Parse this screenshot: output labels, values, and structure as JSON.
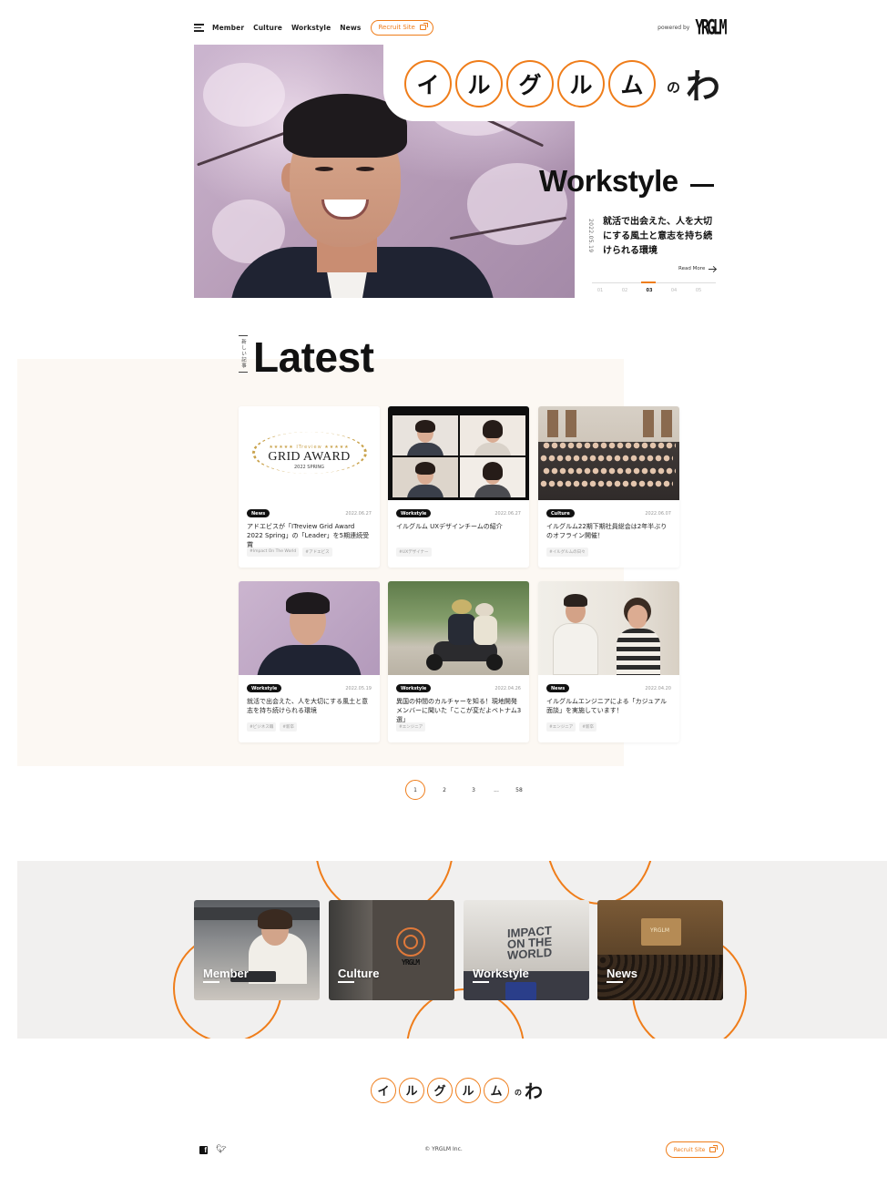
{
  "header": {
    "nav": [
      "Member",
      "Culture",
      "Workstyle",
      "News"
    ],
    "recruit_label": "Recruit Site",
    "powered_by": "powered by",
    "logo_text": "YRGLM"
  },
  "hero": {
    "brand_chars": [
      "イ",
      "ル",
      "グ",
      "ル",
      "ム"
    ],
    "brand_no": "の",
    "brand_wa": "わ",
    "category": "Workstyle",
    "date": "2022.05.19",
    "title": "就活で出会えた、人を大切にする風土と意志を持ち続けられる環境",
    "read_more": "Read More",
    "slides": [
      "01",
      "02",
      "03",
      "04",
      "05"
    ],
    "active_slide": 3
  },
  "latest": {
    "vertical_tag": "新しい記事",
    "title": "Latest",
    "articles": [
      {
        "category": "News",
        "date": "2022.06.27",
        "title": "アドエビスが「ITreview Grid Award 2022 Spring」の「Leader」を5期連続受賞",
        "tags": [
          "#Impact On The World",
          "#アドエビス"
        ],
        "image": {
          "award_title": "GRID AWARD",
          "award_sub": "2022 SPRING",
          "award_stars": "★★★★★ ITreview ★★★★★"
        }
      },
      {
        "category": "Workstyle",
        "date": "2022.06.27",
        "title": "イルグルム UXデザインチームの紹介",
        "tags": [
          "#UXデザイナー"
        ]
      },
      {
        "category": "Culture",
        "date": "2022.06.07",
        "title": "イルグルム22期下期社員総会は2年半ぶりのオフライン開催！",
        "tags": [
          "#イルグルムの日々"
        ]
      },
      {
        "category": "Workstyle",
        "date": "2022.05.19",
        "title": "就活で出会えた、人を大切にする風土と意志を持ち続けられる環境",
        "tags": [
          "#ビジネス職",
          "#新卒"
        ]
      },
      {
        "category": "Workstyle",
        "date": "2022.04.26",
        "title": "異国の仲間のカルチャーを知る！現地開発メンバーに聞いた「ここが変だよベトナム3選」",
        "tags": [
          "#エンジニア"
        ]
      },
      {
        "category": "News",
        "date": "2022.04.20",
        "title": "イルグルムエンジニアによる「カジュアル面談」を実施しています！",
        "tags": [
          "#エンジニア",
          "#新卒"
        ]
      }
    ]
  },
  "pagination": {
    "pages": [
      "1",
      "2",
      "3",
      "...",
      "58"
    ],
    "current": "1"
  },
  "categories": {
    "cards": [
      "Member",
      "Culture",
      "Workstyle",
      "News"
    ],
    "impact_text_1": "IMPACT",
    "impact_text_2": "ON THE WORLD",
    "culture_logo": "YRGLM",
    "news_screen": "YRGLM"
  },
  "footer": {
    "brand_chars": [
      "イ",
      "ル",
      "グ",
      "ル",
      "ム"
    ],
    "brand_no": "の",
    "brand_wa": "わ",
    "copyright": "© YRGLM Inc.",
    "recruit_label": "Recruit Site"
  },
  "colors": {
    "accent": "#ef7d1a",
    "text": "#1b1b1b",
    "latest_bg": "#fcf8f3",
    "band_bg": "#f1f0ef"
  }
}
